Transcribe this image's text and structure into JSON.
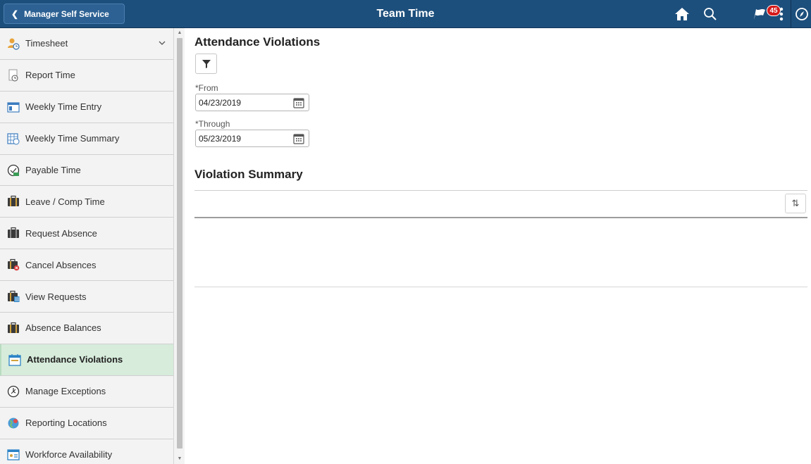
{
  "header": {
    "back_label": "Manager Self Service",
    "title": "Team Time",
    "notification_count": "45",
    "icons": [
      "home-icon",
      "search-icon",
      "flag-icon",
      "actions-menu-icon",
      "navbar-compass-icon"
    ],
    "bg_color": "#1d4f7c"
  },
  "sidebar": {
    "items": [
      {
        "label": "Timesheet",
        "icon": "timesheet-icon"
      },
      {
        "label": "Report Time",
        "icon": "report-time-icon"
      },
      {
        "label": "Weekly Time Entry",
        "icon": "weekly-entry-icon"
      },
      {
        "label": "Weekly Time Summary",
        "icon": "weekly-summary-icon"
      },
      {
        "label": "Payable Time",
        "icon": "payable-time-icon"
      },
      {
        "label": "Leave / Comp Time",
        "icon": "leave-icon"
      },
      {
        "label": "Request Absence",
        "icon": "request-absence-icon"
      },
      {
        "label": "Cancel Absences",
        "icon": "cancel-absence-icon"
      },
      {
        "label": "View Requests",
        "icon": "view-requests-icon"
      },
      {
        "label": "Absence Balances",
        "icon": "absence-balances-icon"
      },
      {
        "label": "Attendance Violations",
        "icon": "attendance-violations-icon"
      },
      {
        "label": "Manage Exceptions",
        "icon": "manage-exceptions-icon"
      },
      {
        "label": "Reporting Locations",
        "icon": "reporting-locations-icon"
      },
      {
        "label": "Workforce Availability",
        "icon": "workforce-availability-icon"
      }
    ],
    "active_color": "#d7ecdb"
  },
  "main": {
    "title": "Attendance Violations",
    "from": {
      "label": "*From",
      "value": "04/23/2019"
    },
    "through": {
      "label": "*Through",
      "value": "05/23/2019"
    },
    "section_title": "Violation Summary"
  }
}
